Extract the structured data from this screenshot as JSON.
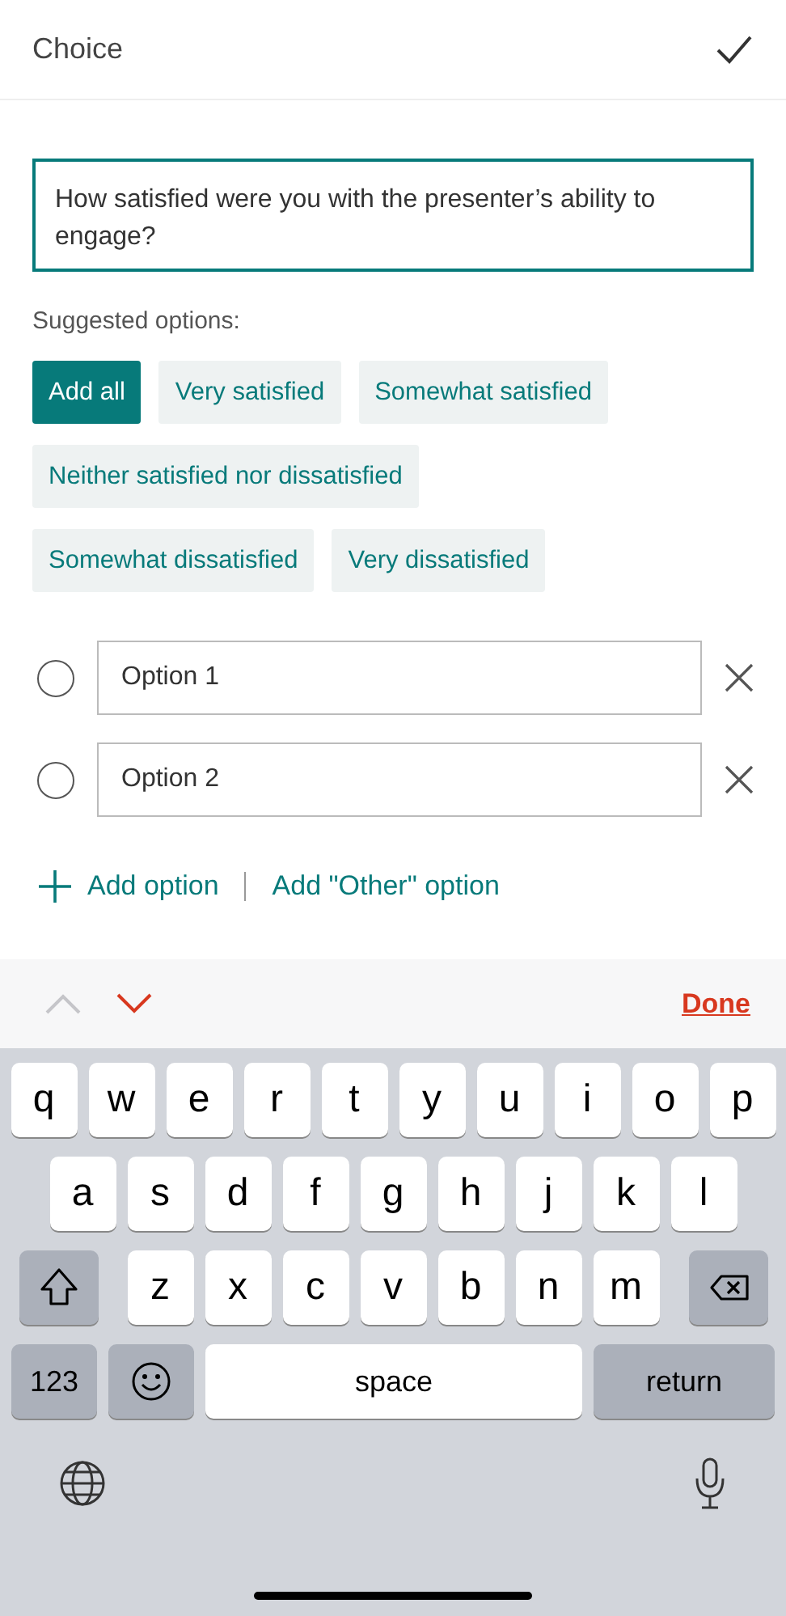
{
  "header": {
    "title": "Choice"
  },
  "question": {
    "value": "How satisfied were you with the presenter’s ability to engage?"
  },
  "suggested_label": "Suggested options:",
  "suggestion_rows": [
    [
      {
        "label": "Add all",
        "kind": "primary"
      },
      {
        "label": "Very satisfied",
        "kind": "chip"
      },
      {
        "label": "Somewhat satisfied",
        "kind": "chip"
      }
    ],
    [
      {
        "label": "Neither satisfied nor dissatisfied",
        "kind": "chip"
      }
    ],
    [
      {
        "label": "Somewhat dissatisfied",
        "kind": "chip"
      },
      {
        "label": "Very dissatisfied",
        "kind": "chip"
      }
    ]
  ],
  "options": [
    {
      "value": "Option 1",
      "checked": false
    },
    {
      "value": "Option 2",
      "checked": false
    }
  ],
  "add_option": "Add option",
  "add_other": "Add \"Other\" option",
  "keyboard": {
    "toolbar": {
      "up_enabled": false,
      "down_enabled": true,
      "done": "Done"
    },
    "key_rows": [
      {
        "keys": [
          {
            "kind": "letter",
            "label": "q"
          },
          {
            "kind": "letter",
            "label": "w"
          },
          {
            "kind": "letter",
            "label": "e"
          },
          {
            "kind": "letter",
            "label": "r"
          },
          {
            "kind": "letter",
            "label": "t"
          },
          {
            "kind": "letter",
            "label": "y"
          },
          {
            "kind": "letter",
            "label": "u"
          },
          {
            "kind": "letter",
            "label": "i"
          },
          {
            "kind": "letter",
            "label": "o"
          },
          {
            "kind": "letter",
            "label": "p"
          }
        ]
      },
      {
        "keys": [
          {
            "kind": "letter",
            "label": "a"
          },
          {
            "kind": "letter",
            "label": "s"
          },
          {
            "kind": "letter",
            "label": "d"
          },
          {
            "kind": "letter",
            "label": "f"
          },
          {
            "kind": "letter",
            "label": "g"
          },
          {
            "kind": "letter",
            "label": "h"
          },
          {
            "kind": "letter",
            "label": "j"
          },
          {
            "kind": "letter",
            "label": "k"
          },
          {
            "kind": "letter",
            "label": "l"
          }
        ]
      },
      {
        "keys": [
          {
            "kind": "shift"
          },
          {
            "kind": "letter",
            "label": "z"
          },
          {
            "kind": "letter",
            "label": "x"
          },
          {
            "kind": "letter",
            "label": "c"
          },
          {
            "kind": "letter",
            "label": "v"
          },
          {
            "kind": "letter",
            "label": "b"
          },
          {
            "kind": "letter",
            "label": "n"
          },
          {
            "kind": "letter",
            "label": "m"
          },
          {
            "kind": "delete"
          }
        ]
      },
      {
        "keys": [
          {
            "kind": "numbers",
            "label": "123"
          },
          {
            "kind": "emoji"
          },
          {
            "kind": "space",
            "label": "space"
          },
          {
            "kind": "return",
            "label": "return"
          }
        ]
      }
    ]
  }
}
